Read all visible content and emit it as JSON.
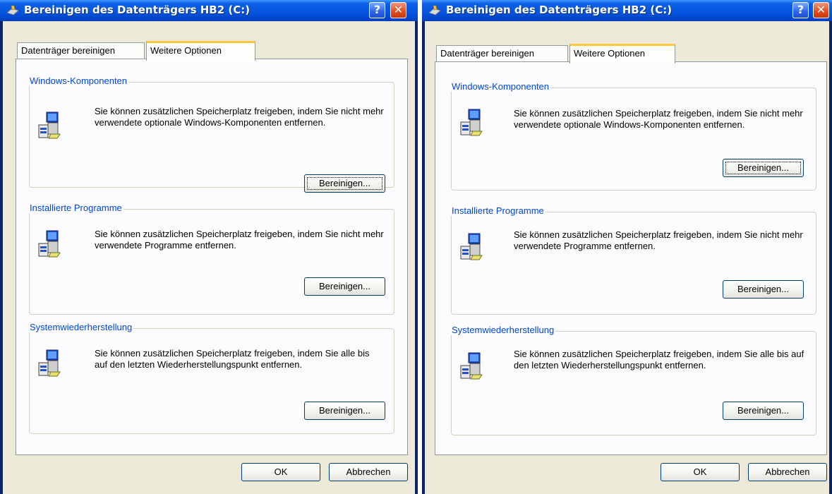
{
  "windows": [
    {
      "title": "Bereinigen des Datenträgers HB2 (C:)",
      "tabs": [
        "Datenträger bereinigen",
        "Weitere Optionen"
      ],
      "groups": [
        {
          "title": "Windows-Komponenten",
          "text": "Sie können zusätzlichen Speicherplatz freigeben, indem Sie nicht mehr verwendete optionale Windows-Komponenten entfernen.",
          "button": "Bereinigen..."
        },
        {
          "title": "Installierte Programme",
          "text": "Sie können zusätzlichen Speicherplatz freigeben, indem Sie nicht mehr verwendete Programme entfernen.",
          "button": "Bereinigen..."
        },
        {
          "title": "Systemwiederherstellung",
          "text": "Sie können zusätzlichen Speicherplatz freigeben, indem Sie alle bis auf den letzten Wiederherstellungspunkt entfernen.",
          "button": "Bereinigen..."
        }
      ],
      "ok": "OK",
      "cancel": "Abbrechen"
    },
    {
      "title": "Bereinigen des Datenträgers HB2 (C:)",
      "tabs": [
        "Datenträger bereinigen",
        "Weitere Optionen"
      ],
      "groups": [
        {
          "title": "Windows-Komponenten",
          "text": "Sie können zusätzlichen Speicherplatz freigeben, indem Sie nicht mehr verwendete optionale Windows-Komponenten entfernen.",
          "button": "Bereinigen..."
        },
        {
          "title": "Installierte Programme",
          "text": "Sie können zusätzlichen Speicherplatz freigeben, indem Sie nicht mehr verwendete Programme entfernen.",
          "button": "Bereinigen..."
        },
        {
          "title": "Systemwiederherstellung",
          "text": "Sie können zusätzlichen Speicherplatz freigeben, indem Sie alle bis auf den letzten Wiederherstellungspunkt entfernen.",
          "button": "Bereinigen..."
        }
      ],
      "ok": "OK",
      "cancel": "Abbrechen"
    }
  ],
  "icons": {
    "title": "disk-cleanup-icon",
    "help": "help-icon",
    "close": "close-icon",
    "group": "computer-components-icon"
  },
  "colors": {
    "titlebar": "#0055e5",
    "close": "#df4a1c",
    "legend": "#0046d5",
    "tab_highlight": "#ffc73c",
    "dialog_bg": "#ece9d8"
  }
}
